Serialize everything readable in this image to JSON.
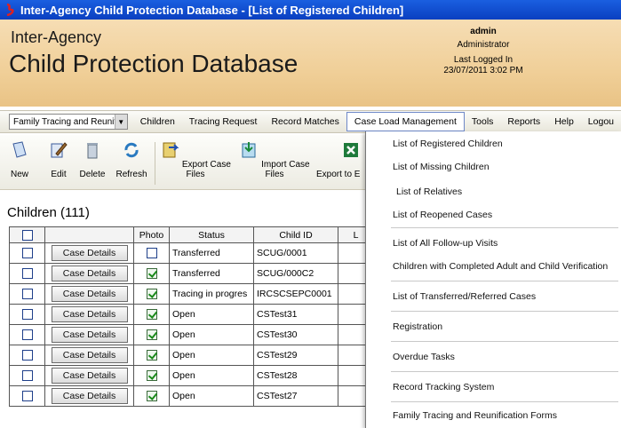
{
  "window": {
    "title": "Inter-Agency Child Protection Database - [List of Registered Children]"
  },
  "header": {
    "brand_line1": "Inter-Agency",
    "brand_line2": "Child Protection Database",
    "user": {
      "name": "admin",
      "role": "Administrator",
      "last_logged_label": "Last Logged In",
      "last_logged_value": "23/07/2011 3:02 PM"
    }
  },
  "menubar": {
    "module": "Family Tracing and Reunificatio",
    "items": [
      "Children",
      "Tracing Request",
      "Record Matches",
      "Case Load Management",
      "Tools",
      "Reports",
      "Help",
      "Logou"
    ],
    "active": "Case Load Management"
  },
  "toolbar": {
    "buttons": [
      "New",
      "Edit",
      "Delete",
      "Refresh",
      "Export Case Files",
      "Import Case Files",
      "Export to E"
    ]
  },
  "section": {
    "title": "Children (111)"
  },
  "grid": {
    "columns": [
      "",
      "",
      "Photo",
      "Status",
      "Child ID",
      "L"
    ],
    "case_button_label": "Case Details",
    "rows": [
      {
        "photo_checked": false,
        "status": "Transferred",
        "child_id": "SCUG/0001"
      },
      {
        "photo_checked": true,
        "status": "Transferred",
        "child_id": "SCUG/000C2"
      },
      {
        "photo_checked": true,
        "status": "Tracing in progres",
        "child_id": "IRCSCSEPC0001"
      },
      {
        "photo_checked": true,
        "status": "Open",
        "child_id": "CSTest31"
      },
      {
        "photo_checked": true,
        "status": "Open",
        "child_id": "CSTest30"
      },
      {
        "photo_checked": true,
        "status": "Open",
        "child_id": "CSTest29"
      },
      {
        "photo_checked": true,
        "status": "Open",
        "child_id": "CSTest28"
      },
      {
        "photo_checked": true,
        "status": "Open",
        "child_id": "CSTest27"
      }
    ]
  },
  "dropdown": {
    "items": [
      "List of Registered Children",
      "List of Missing Children",
      "List of Relatives",
      "List of Reopened Cases",
      "List of All Follow-up Visits",
      "Children with Completed Adult and Child Verification",
      "List of Transferred/Referred Cases",
      "Registration",
      "Overdue Tasks",
      "Record Tracking System",
      "Family Tracing and Reunification Forms"
    ]
  },
  "colors": {
    "title_bar": "#0a3fc0",
    "header_bg": "#f0cf98",
    "check_green": "#1a8a1a"
  }
}
